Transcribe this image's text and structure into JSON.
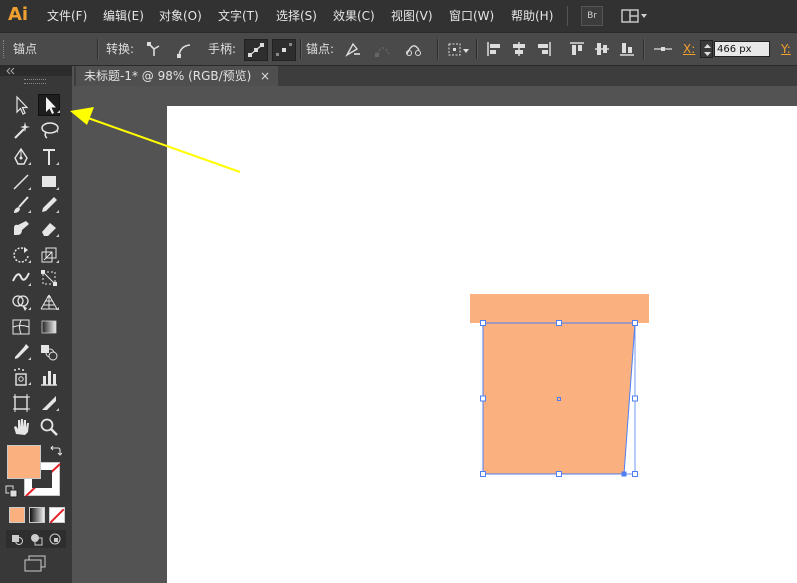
{
  "app": {
    "logo": "Ai"
  },
  "menu": [
    "文件(F)",
    "编辑(E)",
    "对象(O)",
    "文字(T)",
    "选择(S)",
    "效果(C)",
    "视图(V)",
    "窗口(W)",
    "帮助(H)"
  ],
  "menu_buttons": {
    "bridge": "Br"
  },
  "options": {
    "anchor_label": "锚点",
    "convert_label": "转换:",
    "handles_label": "手柄:",
    "anchors_label": "锚点:",
    "x_label": "X:",
    "x_value": "466 px",
    "y_label": "Y:"
  },
  "document": {
    "tab_title": "未标题-1* @ 98% (RGB/预览)",
    "close_glyph": "×"
  },
  "colors": {
    "fill": "#fbb07f",
    "selection": "#4f7ff0",
    "annotation_arrow": "#ffff00",
    "logo": "#f0a030"
  }
}
